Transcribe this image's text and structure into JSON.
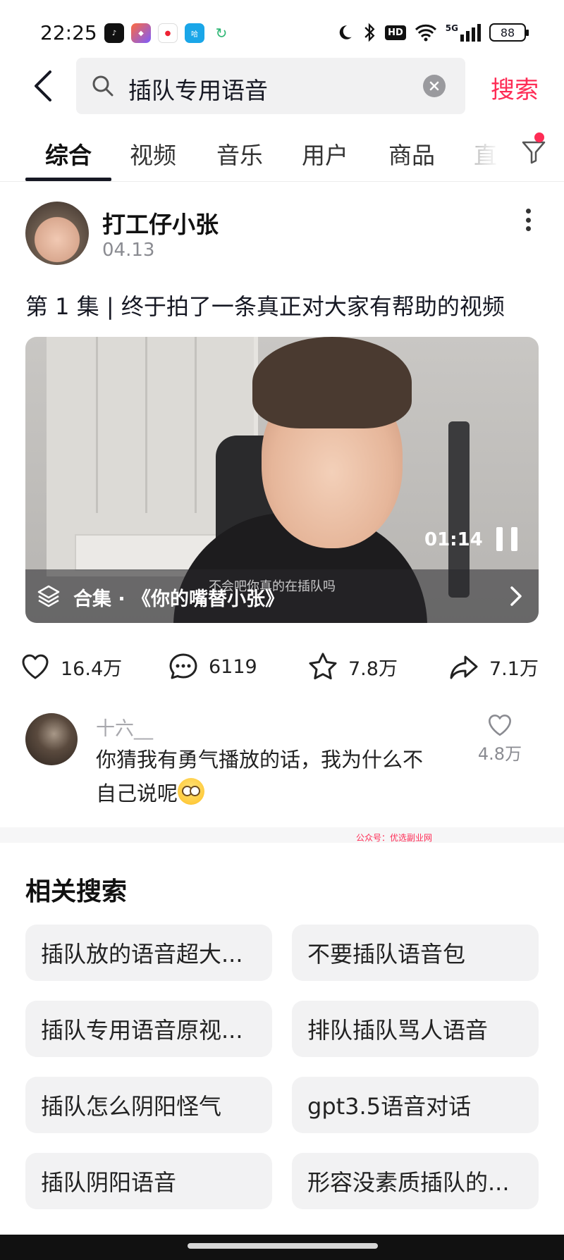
{
  "status_bar": {
    "time": "22:25",
    "app_icons": [
      "tiktok-icon",
      "gallery-icon",
      "maps-icon",
      "hello-bike-icon",
      "refresh-icon"
    ],
    "network": "5G",
    "hd_label": "HD",
    "battery": "88"
  },
  "search": {
    "query": "插队专用语音",
    "submit_label": "搜索"
  },
  "tabs": [
    {
      "label": "综合",
      "active": true
    },
    {
      "label": "视频"
    },
    {
      "label": "音乐"
    },
    {
      "label": "用户"
    },
    {
      "label": "商品"
    },
    {
      "label": "直"
    }
  ],
  "post": {
    "author": "打工仔小张",
    "date": "04.13",
    "title": "第 1 集 | 终于拍了一条真正对大家有帮助的视频",
    "video": {
      "time": "01:14",
      "subtitle": "不会吧你真的在插队吗",
      "collection_label": "合集 · 《你的嘴替小张》"
    },
    "stats": {
      "likes": "16.4万",
      "comments": "6119",
      "favorites": "7.8万",
      "shares": "7.1万"
    }
  },
  "top_comment": {
    "user": "十六__",
    "text": "你猜我有勇气播放的话，我为什么不自己说呢",
    "likes": "4.8万"
  },
  "watermark": "公众号：优选副业网",
  "related": {
    "title": "相关搜索",
    "items": [
      "插队放的语音超大...",
      "不要插队语音包",
      "插队专用语音原视...",
      "排队插队骂人语音",
      "插队怎么阴阳怪气",
      "gpt3.5语音对话",
      "插队阴阳语音",
      "形容没素质插队的..."
    ]
  },
  "colors": {
    "accent": "#fe2c55",
    "text_primary": "#161823",
    "text_secondary": "#8a8b91",
    "chip_bg": "#f2f2f3"
  }
}
